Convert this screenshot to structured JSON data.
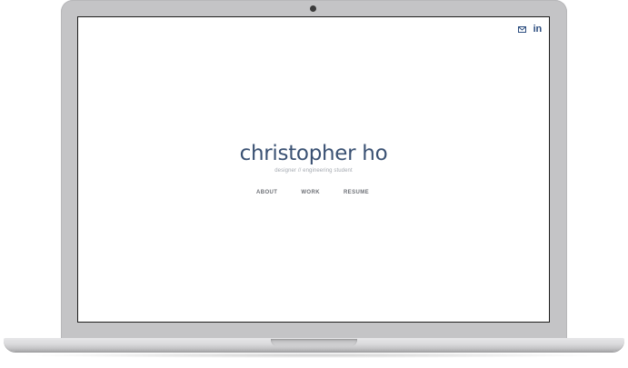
{
  "colors": {
    "name": "#3a5173",
    "tagline": "#a4a9b0",
    "nav": "#6d7076",
    "social": "#2d4e80"
  },
  "social": {
    "icons": [
      "mail-icon",
      "linkedin-icon"
    ],
    "linkedin_label": "in"
  },
  "hero": {
    "name": "christopher ho",
    "tagline": "designer // engineering student"
  },
  "nav": {
    "items": [
      {
        "label": "ABOUT"
      },
      {
        "label": "WORK"
      },
      {
        "label": "RESUME"
      }
    ]
  }
}
